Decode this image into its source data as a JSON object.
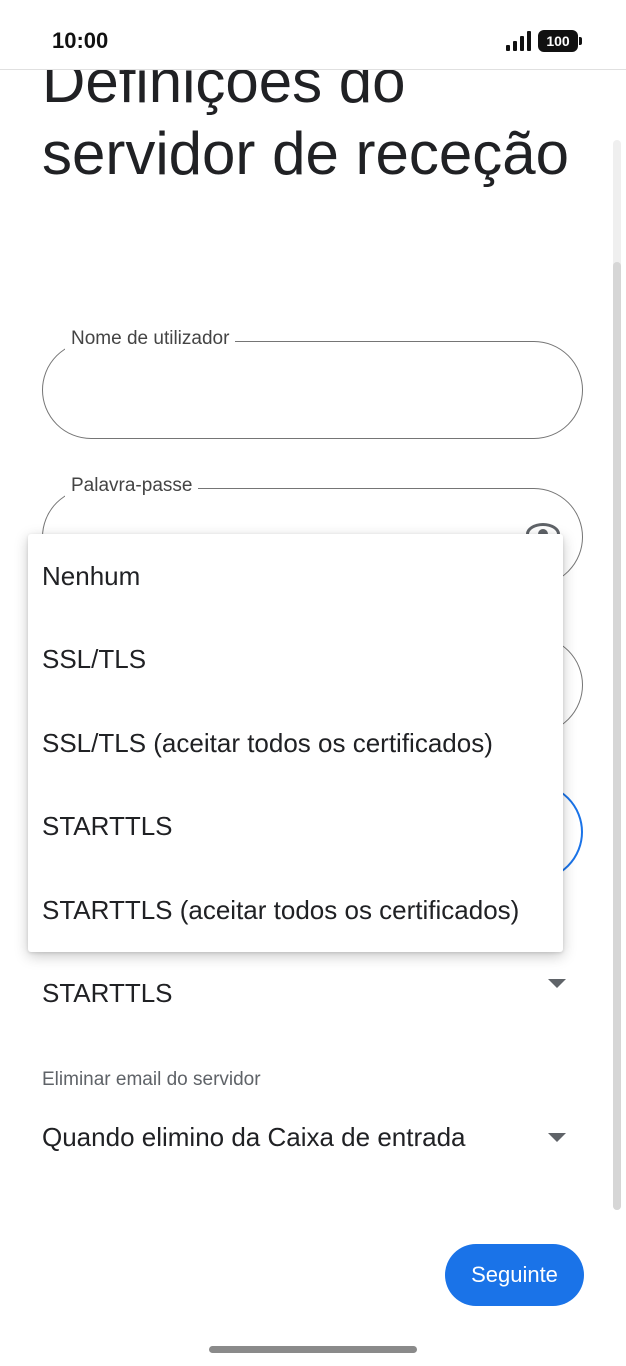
{
  "status_bar": {
    "time": "10:00",
    "battery": "100"
  },
  "page": {
    "title": "Definições do servidor de receção"
  },
  "form": {
    "username": {
      "label": "Nome de utilizador",
      "value": ""
    },
    "password": {
      "label": "Palavra-passe",
      "value": ""
    },
    "security": {
      "selected": "STARTTLS"
    },
    "delete_from_server": {
      "label": "Eliminar email do servidor",
      "selected": "Quando elimino da Caixa de entrada"
    }
  },
  "security_menu": {
    "options": [
      "Nenhum",
      "SSL/TLS",
      "SSL/TLS (aceitar todos os certificados)",
      "STARTTLS",
      "STARTTLS (aceitar todos os certificados)"
    ]
  },
  "actions": {
    "next_label": "Seguinte"
  },
  "colors": {
    "accent": "#1a73e8",
    "outline": "#757575",
    "text": "#202124"
  }
}
